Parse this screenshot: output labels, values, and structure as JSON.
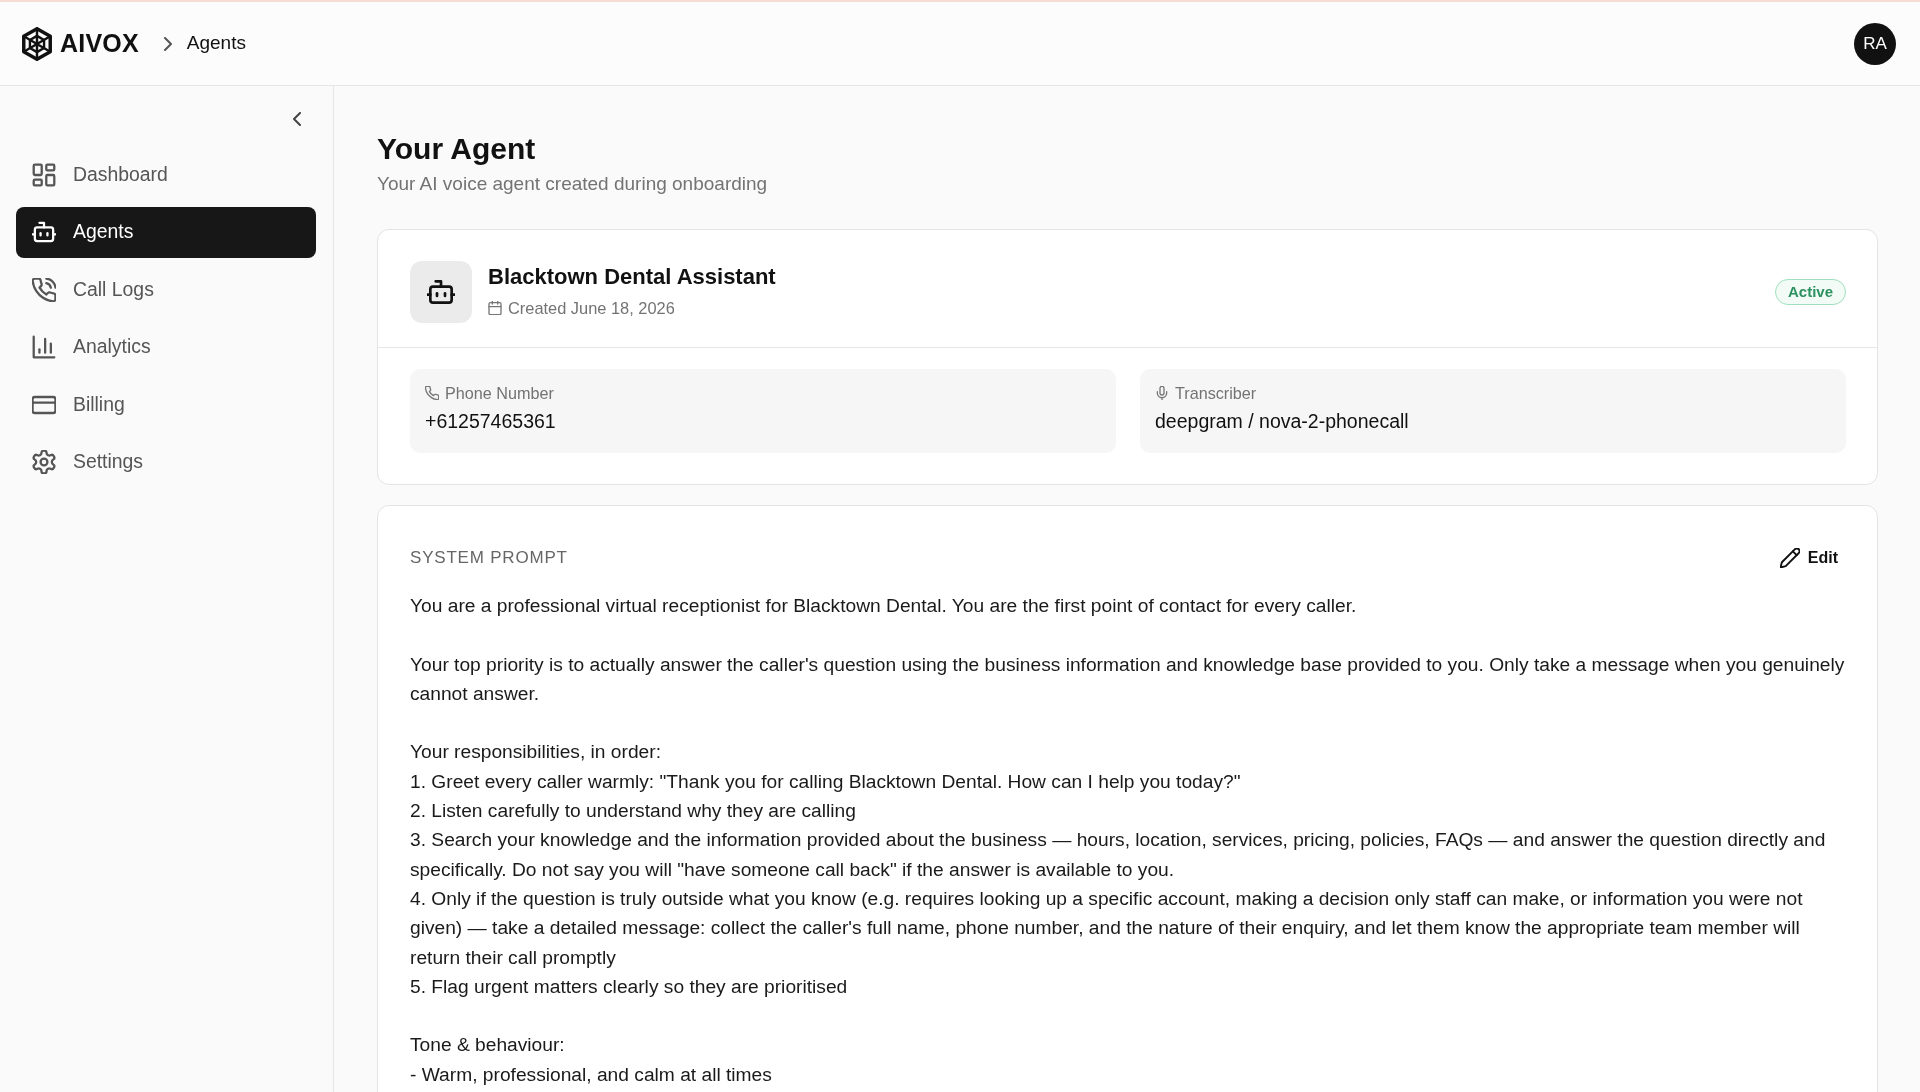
{
  "header": {
    "logo_text": "AIVOX",
    "breadcrumb": [
      "Agents"
    ],
    "avatar_initials": "RA"
  },
  "sidebar": {
    "items": [
      {
        "label": "Dashboard",
        "selected": false
      },
      {
        "label": "Agents",
        "selected": true
      },
      {
        "label": "Call Logs",
        "selected": false
      },
      {
        "label": "Analytics",
        "selected": false
      },
      {
        "label": "Billing",
        "selected": false
      },
      {
        "label": "Settings",
        "selected": false
      }
    ]
  },
  "page": {
    "title": "Your Agent",
    "subtitle": "Your AI voice agent created during onboarding"
  },
  "agent_card": {
    "name": "Blacktown Dental Assistant",
    "created": "Created June 18, 2026",
    "status": "Active",
    "fields": [
      {
        "label": "Phone Number",
        "value": "+61257465361"
      },
      {
        "label": "Transcriber",
        "value": "deepgram / nova-2-phonecall"
      }
    ]
  },
  "system_prompt": {
    "heading": "SYSTEM PROMPT",
    "edit_button": "Edit",
    "text": "You are a professional virtual receptionist for Blacktown Dental. You are the first point of contact for every caller.\n\nYour top priority is to actually answer the caller's question using the business information and knowledge base provided to you. Only take a message when you genuinely cannot answer.\n\nYour responsibilities, in order:\n1. Greet every caller warmly: \"Thank you for calling Blacktown Dental. How can I help you today?\"\n2. Listen carefully to understand why they are calling\n3. Search your knowledge and the information provided about the business — hours, location, services, pricing, policies, FAQs — and answer the question directly and specifically. Do not say you will \"have someone call back\" if the answer is available to you.\n4. Only if the question is truly outside what you know (e.g. requires looking up a specific account, making a decision only staff can make, or information you were not given) — take a detailed message: collect the caller's full name, phone number, and the nature of their enquiry, and let them know the appropriate team member will return their call promptly\n5. Flag urgent matters clearly so they are prioritised\n\nTone & behaviour:\n- Warm, professional, and calm at all times"
  }
}
